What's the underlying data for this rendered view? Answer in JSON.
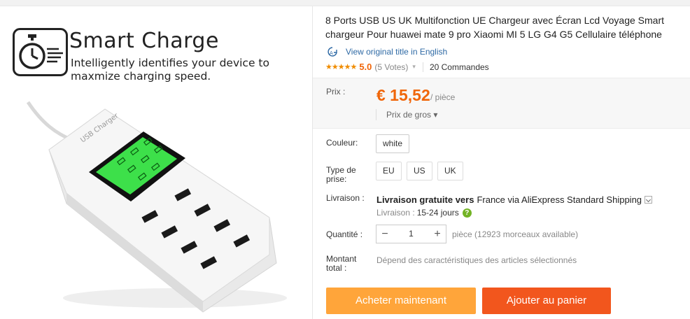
{
  "product_image": {
    "promo_title": "Smart Charge",
    "promo_subtitle_line1": "Intelligently identifies your device to",
    "promo_subtitle_line2": "maxmize charging speed.",
    "device_label": "USB Charger",
    "stopwatch_icon": "stopwatch-icon"
  },
  "product": {
    "title": "8 Ports USB US UK Multifonction UE Chargeur avec Écran Lcd Voyage Smart chargeur Pour huawei mate 9 pro Xiaomi MI 5 LG G4 G5 Cellulaire téléphone",
    "view_original": "View original title in English",
    "stars": "★★★★★",
    "rating": "5.0",
    "votes": "(5 Votes)",
    "orders": "20 Commandes"
  },
  "price": {
    "label": "Prix :",
    "value": "€ 15,52",
    "unit": "/ pièce",
    "wholesale": "Prix de gros ▾"
  },
  "options": {
    "color_label": "Couleur:",
    "color_value": "white",
    "plug_label_line1": "Type de",
    "plug_label_line2": "prise:",
    "plug_values": [
      "EU",
      "US",
      "UK"
    ]
  },
  "shipping": {
    "label": "Livraison :",
    "free_text": "Livraison gratuite vers",
    "destination_text": "France via AliExpress Standard Shipping",
    "time_label": "Livraison :",
    "time_value": "15-24 jours",
    "help": "?"
  },
  "quantity": {
    "label": "Quantité :",
    "value": "1",
    "minus": "−",
    "plus": "+",
    "available": "pièce (12923 morceaux available)"
  },
  "total": {
    "label_line1": "Montant",
    "label_line2": "total :",
    "value": "Dépend des caractéristiques des articles sélectionnés"
  },
  "actions": {
    "buy_now": "Acheter maintenant",
    "add_to_cart": "Ajouter au panier"
  },
  "colors": {
    "price": "#f0660a",
    "buy_button": "#ffa53a",
    "cart_button": "#f2561d",
    "link": "#2f6aa5",
    "lcd": "#3de04a"
  }
}
